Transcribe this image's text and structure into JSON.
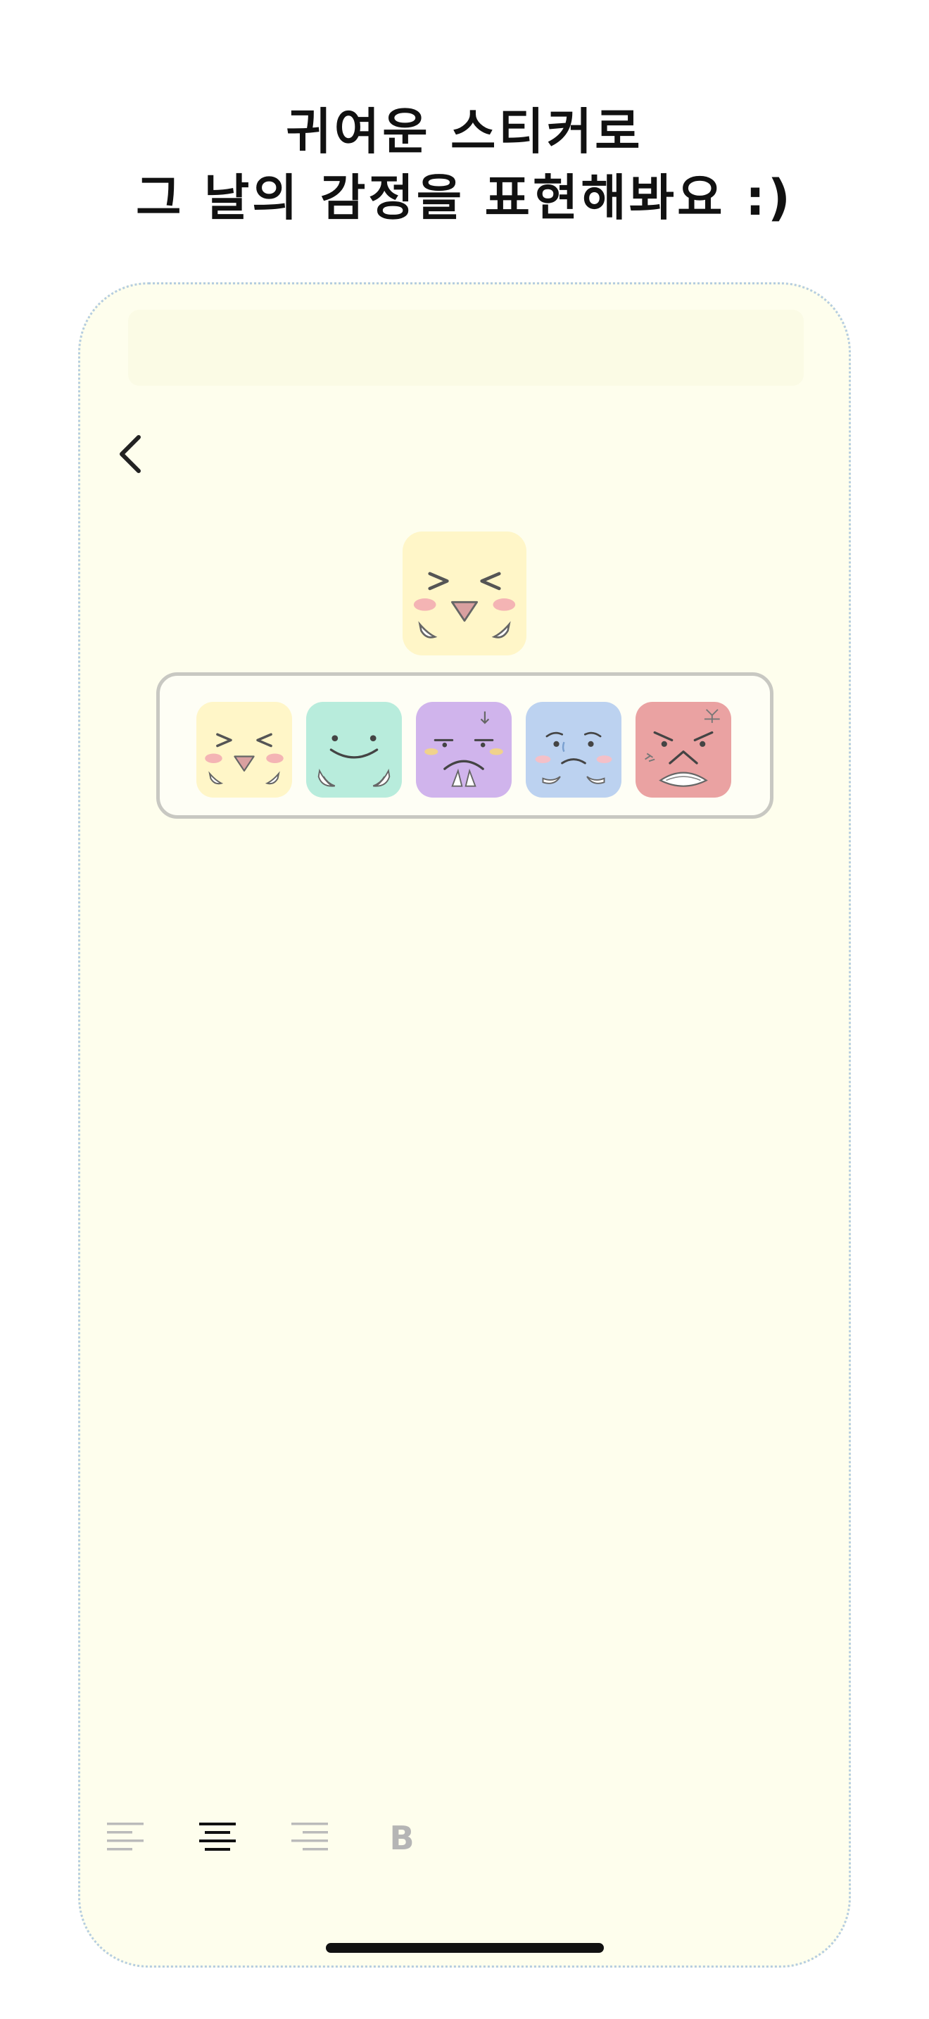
{
  "headline": {
    "line1": "귀여운 스티커로",
    "line2": "그 날의 감정을 표현해봐요 :)"
  },
  "navigation": {
    "back_icon": "chevron-left-icon"
  },
  "selected_sticker": {
    "mood": "happy",
    "color": "#fff6c8"
  },
  "sticker_tray": {
    "items": [
      {
        "mood": "happy",
        "color": "#fff6c8"
      },
      {
        "mood": "content",
        "color": "#b8ecdc"
      },
      {
        "mood": "annoyed",
        "color": "#d0b4ec"
      },
      {
        "mood": "sad",
        "color": "#bcd2f0"
      },
      {
        "mood": "angry",
        "color": "#eaa2a2"
      }
    ]
  },
  "toolbar": {
    "align_left_icon": "align-left-icon",
    "align_center_icon": "align-center-icon",
    "align_right_icon": "align-right-icon",
    "bold_label": "B",
    "active": "align-center"
  },
  "colors": {
    "background": "#fefeed",
    "border": "#b5cde0",
    "active_tool": "#111111",
    "inactive_tool": "#bbbbbb"
  }
}
